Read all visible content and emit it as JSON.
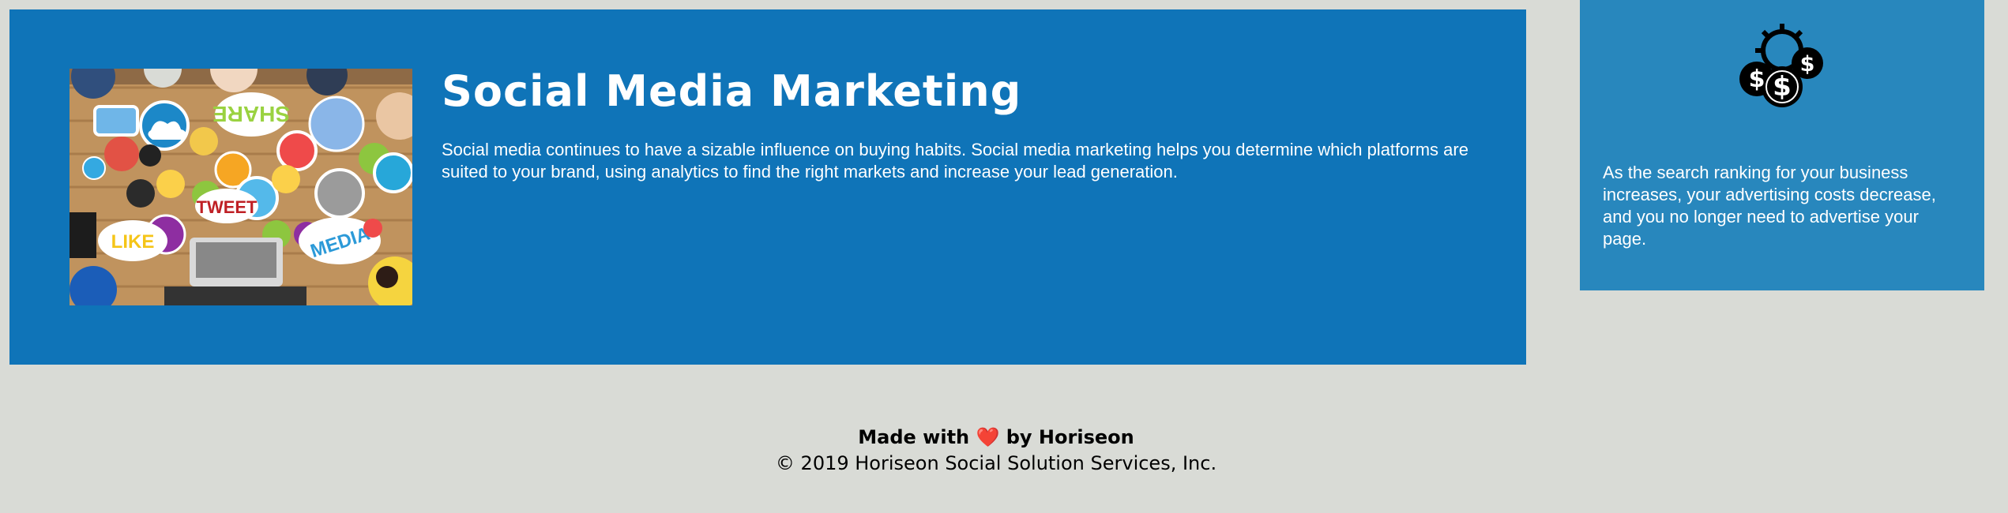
{
  "main_card": {
    "title": "Social Media Marketing",
    "text": "Social media continues to have a sizable influence on buying habits. Social media marketing helps you determine which platforms are suited to your brand, using analytics to find the right markets and increase your lead generation.",
    "image": {
      "labels": {
        "share": "SHARE",
        "tweet": "TWEET",
        "like": "LIKE",
        "media": "MEDIA"
      }
    }
  },
  "side_card": {
    "icon": "money-gear-icon",
    "text": "As the search ranking for your business increases, your advertising costs decrease, and you no longer need to advertise your page."
  },
  "footer": {
    "made_with": "Made with",
    "heart": "❤️",
    "by": "by Horiseon",
    "copyright": "© 2019 Horiseon Social Solution Services, Inc."
  },
  "colors": {
    "background": "#d9dbd6",
    "main_card": "#0f74b8",
    "side_card": "#2887bd",
    "heart": "#e01b24"
  }
}
